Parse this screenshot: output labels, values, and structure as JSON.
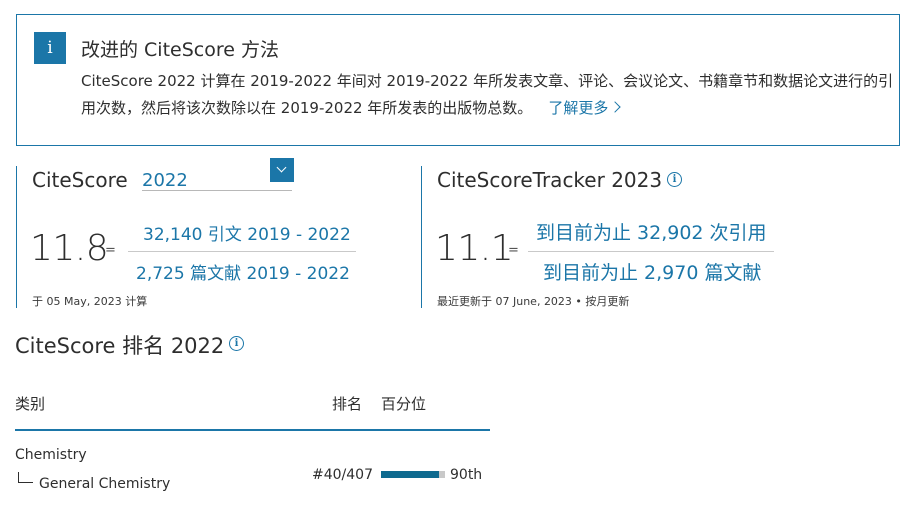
{
  "info": {
    "icon": "i",
    "title": "改进的 CiteScore 方法",
    "line1": "CiteScore 2022 计算在 2019-2022 年间对 2019-2022 年所发表文章、评论、会议论文、书籍章节和数据论文进行的引",
    "line2": "用次数，然后将该次数除以在 2019-2022 年所发表的出版物总数。",
    "learn_more": "了解更多"
  },
  "citescore": {
    "label": "CiteScore",
    "year_selected": "2022",
    "value": "11.8",
    "equals": "=",
    "citations": "32,140 引文 2019 - 2022",
    "documents": "2,725 篇文献 2019 - 2022",
    "footnote": "于 05 May, 2023 计算"
  },
  "tracker": {
    "label": "CiteScoreTracker 2023",
    "value": "11.1",
    "equals": "=",
    "citations": "到目前为止 32,902 次引用",
    "documents": "到目前为止 2,970 篇文献",
    "footnote": "最近更新于 07 June, 2023 • 按月更新"
  },
  "rank": {
    "title": "CiteScore 排名 2022",
    "headers": {
      "category": "类别",
      "rank": "排名",
      "percentile": "百分位"
    },
    "rows": [
      {
        "field": "Chemistry",
        "subfield": "General Chemistry",
        "rank": "#40/407",
        "percentile_label": "90th",
        "percentile": 90
      }
    ]
  },
  "colors": {
    "accent": "#1b76a8",
    "bar": "#0e6a8f",
    "bar_track": "#c9c9c9"
  },
  "icons": [
    "info-icon",
    "chevron-right-icon",
    "chevron-down-icon",
    "info-circle-icon",
    "tree-branch-icon"
  ]
}
